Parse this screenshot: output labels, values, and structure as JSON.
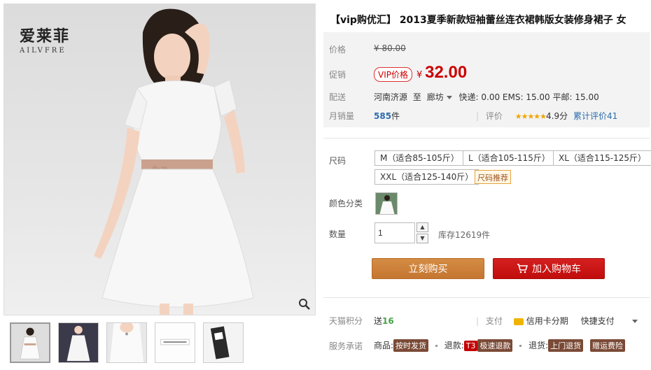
{
  "product": {
    "title": "【vip购优汇】 2013夏季新款短袖蕾丝连衣裙韩版女装修身裙子 女",
    "brand_cn": "爱莱菲",
    "brand_en": "AILVFRE"
  },
  "pricing": {
    "orig_label": "价格",
    "orig_price": "¥ 80.00",
    "promo_label": "促销",
    "vip_badge": "VIP价格",
    "yen": "¥",
    "promo_price": "32.00"
  },
  "shipping": {
    "label": "配送",
    "from": "河南济源",
    "to_word": "至",
    "dest": "廊坊",
    "fees": "快递: 0.00 EMS: 15.00 平邮: 15.00"
  },
  "sales": {
    "label": "月销量",
    "count": "585",
    "unit": "件",
    "rating_label": "评价",
    "stars": "★★★★★",
    "score": "4.9分",
    "rating_count": "累计评价41"
  },
  "options": {
    "size_label": "尺码",
    "sizes": [
      "M（适合85-105斤）",
      "L（适合105-115斤）",
      "XL（适合115-125斤）",
      "XXL（适合125-140斤）"
    ],
    "size_tip": "尺码推荐",
    "color_label": "颜色分类",
    "qty_label": "数量",
    "qty_value": "1",
    "stock": "库存12619件"
  },
  "actions": {
    "buy_now": "立刻购买",
    "add_cart": "加入购物车"
  },
  "footer": {
    "points_label": "天猫积分",
    "points_prefix": "送",
    "points_value": "16",
    "pay_label": "支付",
    "pay_card": "信用卡分期",
    "pay_fast": "快捷支付",
    "service_label": "服务承诺",
    "svc1_prefix": "商品:",
    "svc1_tag": "按时发货",
    "svc2_prefix": "退款:",
    "svc2_tag1": "T3",
    "svc2_tag2": "极速退款",
    "svc3_prefix": "退货:",
    "svc3_tag": "上门退货",
    "svc4_tag": "赠运费险"
  },
  "colors": {
    "price_red": "#c00000",
    "buy_orange": "#c97a34",
    "cart_red": "#c80f0f",
    "link_blue": "#2c6cae"
  }
}
